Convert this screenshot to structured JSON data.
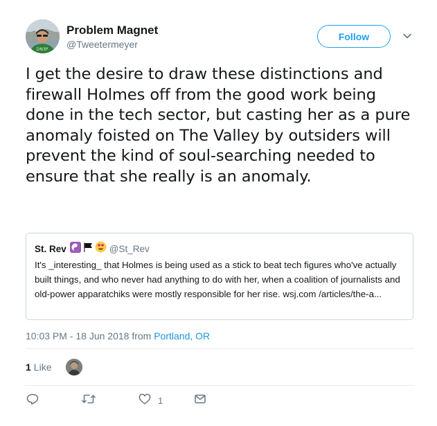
{
  "author": {
    "display_name": "Problem Magnet",
    "handle": "@Tweetermeyer",
    "avatar_shirt_text": "DN3P"
  },
  "follow_button": {
    "label": "Follow"
  },
  "tweet": {
    "text": "I get the desire to draw these distinctions and firewall Holmes off from the good work being done in the tech sector, but casting her as a pure anomaly foisted on The Valley by outsiders will prevent the kind of soul-searching needed to ensure that she really is an anomaly."
  },
  "quoted_tweet": {
    "display_name": "St. Rev",
    "emoji_icons": [
      "yin-yang-icon",
      "black-flag-icon",
      "heart-eyes-emoji-icon"
    ],
    "handle": "@St_Rev",
    "text": "It's _interesting_ that Holmes is being used as a stick to beat tech figures who've actually built things, and who never had anything to do with her, when a coalition of journalists and old-power apparatchiks were mostly responsible for her rise. wsj.com /articles/the-a..."
  },
  "meta": {
    "timestamp": "10:03 PM - 18 Jun 2018",
    "from_label": "from",
    "location": "Portland, OR"
  },
  "stats": {
    "likes_count": "1",
    "likes_label": "Like"
  },
  "actions": {
    "reply_count": "",
    "retweet_count": "",
    "like_count": "1",
    "dm_count": ""
  },
  "colors": {
    "accent": "#1da1f2",
    "link": "#1b95e0",
    "secondary_text": "#657786",
    "primary_text": "#14171a",
    "border": "#ccd6dd",
    "divider": "#e6ecf0"
  }
}
